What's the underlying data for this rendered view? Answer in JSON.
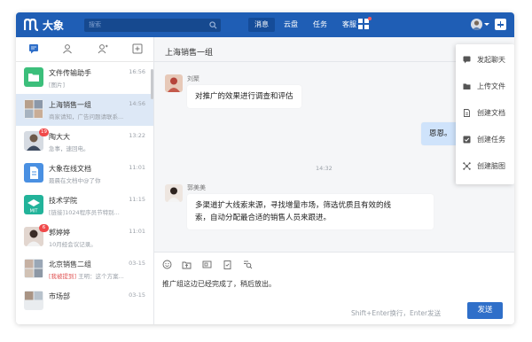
{
  "app": {
    "name": "大象"
  },
  "search": {
    "placeholder": "搜索"
  },
  "nav": {
    "items": [
      "消息",
      "云盘",
      "任务",
      "客服"
    ],
    "active": 0
  },
  "colors": {
    "brand": "#1f5eb5",
    "accent": "#2f6fc9",
    "badge": "#f0494a",
    "selected_row": "#dde8f6",
    "my_bubble": "#cfe3fb"
  },
  "sidebar": {
    "tab_icons": [
      "chat-icon",
      "contacts-icon",
      "user-icon",
      "add-chat-icon"
    ],
    "conversations": [
      {
        "name": "文件传输助手",
        "preview": "[图片]",
        "preview_tag": "",
        "time": "16:56",
        "avatar": "folder-avatar",
        "badge": ""
      },
      {
        "name": "上海销售一组",
        "preview": "商家请知，广告问题请联系...",
        "preview_tag": "",
        "time": "14:56",
        "avatar": "group-avatar",
        "badge": ""
      },
      {
        "name": "陶大大",
        "preview": "急事，速回电。",
        "preview_tag": "",
        "time": "13:22",
        "avatar": "person-avatar",
        "badge": "19"
      },
      {
        "name": "大象在线文档",
        "preview": "聂晨在文档中@了你",
        "preview_tag": "",
        "time": "11:01",
        "avatar": "doc-avatar",
        "badge": ""
      },
      {
        "name": "技术学院",
        "preview": "[链接]1024程序员节特别...",
        "preview_tag": "",
        "time": "11:15",
        "avatar": "mit-avatar",
        "badge": ""
      },
      {
        "name": "郭婷婷",
        "preview": "10月经会议记录。",
        "preview_tag": "",
        "time": "11:01",
        "avatar": "person-avatar",
        "badge": "6"
      },
      {
        "name": "北京销售二组",
        "preview": "王明：这个方案...",
        "preview_tag": "[我被提到]",
        "time": "03-15",
        "avatar": "group-avatar",
        "badge": ""
      },
      {
        "name": "市场部",
        "preview": "",
        "preview_tag": "",
        "time": "03-15",
        "avatar": "group-avatar",
        "badge": ""
      }
    ]
  },
  "chat": {
    "title": "上海销售一组",
    "time_separator": "14:32",
    "messages": [
      {
        "sender": "刘聚",
        "text": "对推广的效果进行调查和评估",
        "mine": false
      },
      {
        "sender": "",
        "text": "恩恩。",
        "mine": true
      },
      {
        "sender": "郭美美",
        "text_line1": "多渠道扩大线索来源，寻找增量市场，筛选优质且有效的线",
        "text_line2": "索，自动分配最合适的销售人员来跟进。",
        "mine": false
      }
    ],
    "toolbar_icons": [
      "emoji-icon",
      "upload-file-icon",
      "screenshot-icon",
      "task-icon",
      "search-history-icon"
    ],
    "draft": "推广组这边已经完成了，稍后放出。",
    "send_hint": "Shift+Enter换行，Enter发送",
    "send_label": "发送"
  },
  "menu": {
    "items": [
      {
        "label": "发起聊天",
        "icon": "chat-icon"
      },
      {
        "label": "上传文件",
        "icon": "folder-icon"
      },
      {
        "label": "创建文档",
        "icon": "document-icon"
      },
      {
        "label": "创建任务",
        "icon": "task-check-icon"
      },
      {
        "label": "创建脑图",
        "icon": "mindmap-icon"
      }
    ]
  }
}
